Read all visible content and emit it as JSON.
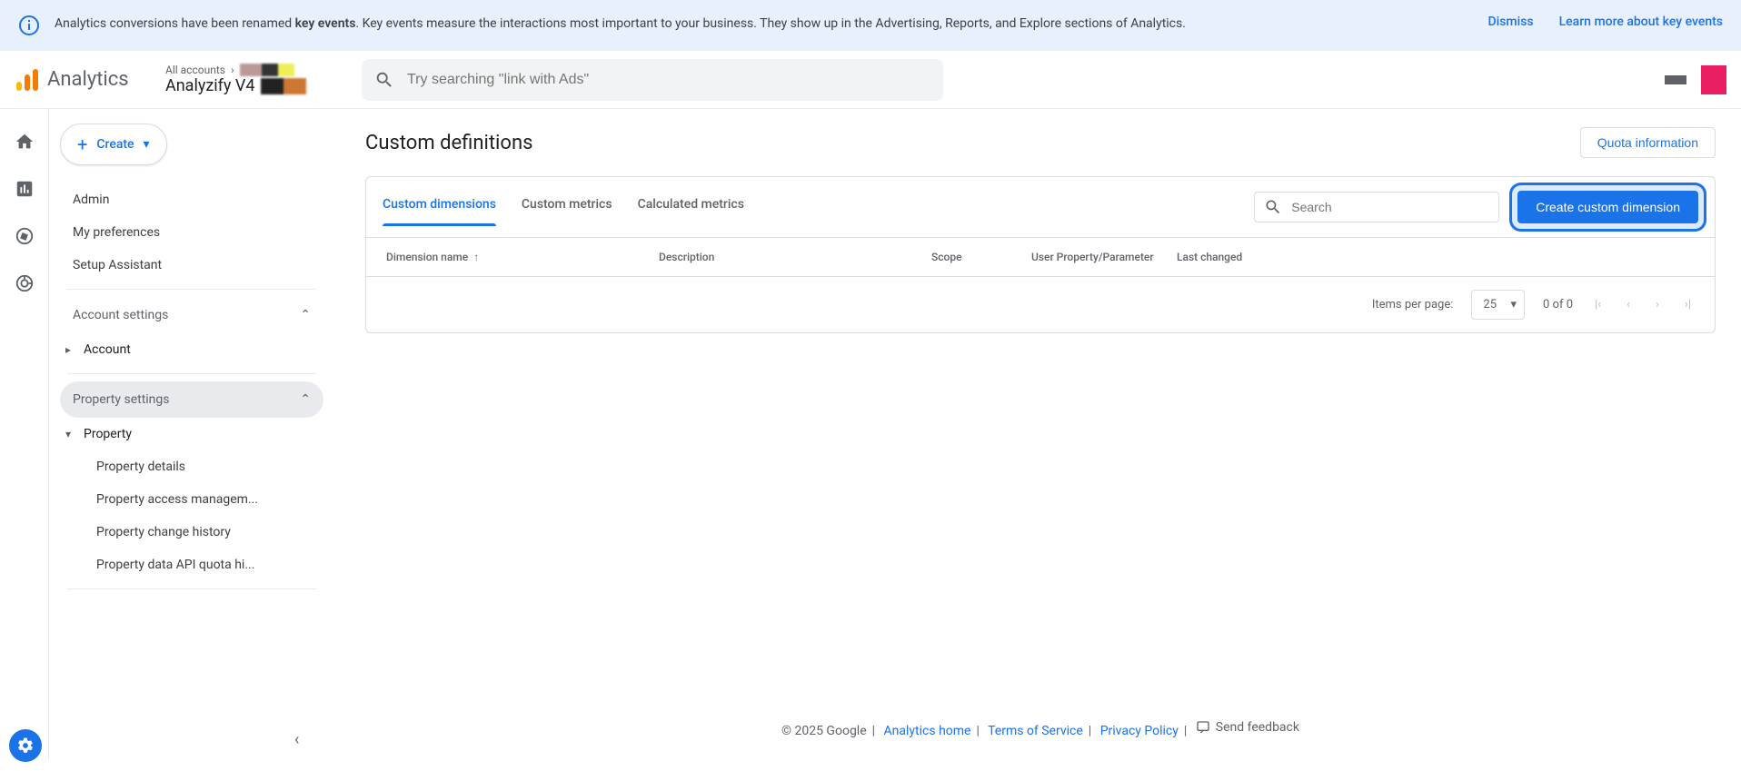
{
  "banner": {
    "text_before": "Analytics conversions have been renamed ",
    "text_bold": "key events",
    "text_after": ". Key events measure the interactions most important to your business. They show up in the Advertising, Reports, and Explore sections of Analytics.",
    "dismiss": "Dismiss",
    "learn_more": "Learn more about key events"
  },
  "header": {
    "product": "Analytics",
    "breadcrumb_top": "All accounts",
    "breadcrumb_bottom": "Analyzify V4",
    "search_placeholder": "Try searching \"link with Ads\""
  },
  "sidebar": {
    "create": "Create",
    "items": [
      "Admin",
      "My preferences",
      "Setup Assistant"
    ],
    "account_section": "Account settings",
    "account_item": "Account",
    "property_section": "Property settings",
    "property_item": "Property",
    "property_children": [
      "Property details",
      "Property access managem...",
      "Property change history",
      "Property data API quota hi..."
    ]
  },
  "page": {
    "title": "Custom definitions",
    "quota": "Quota information",
    "tabs": [
      "Custom dimensions",
      "Custom metrics",
      "Calculated metrics"
    ],
    "search_placeholder": "Search",
    "create_button": "Create custom dimension",
    "columns": [
      "Dimension name",
      "Description",
      "Scope",
      "User Property/Parameter",
      "Last changed"
    ],
    "items_per_page_label": "Items per page:",
    "items_per_page_value": "25",
    "range": "0 of 0"
  },
  "footer": {
    "copyright": "© 2025 Google",
    "links": [
      "Analytics home",
      "Terms of Service",
      "Privacy Policy"
    ],
    "feedback": "Send feedback"
  }
}
